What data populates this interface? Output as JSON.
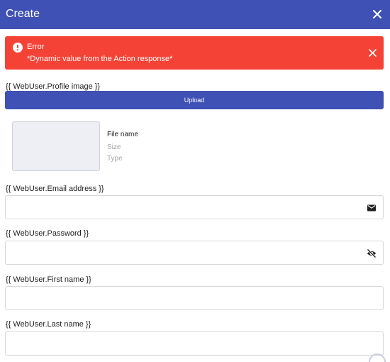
{
  "dialog": {
    "title": "Create",
    "close_icon": "close-icon"
  },
  "alert": {
    "title": "Error",
    "message": "*Dynamic value from the Action response*",
    "icon": "error-icon",
    "background_color": "#f44336"
  },
  "profile_image": {
    "label": "{{ WebUser.Profile image }}",
    "upload_label": "Upload",
    "file_name": "File name",
    "file_size": "Size",
    "file_type": "Type"
  },
  "email": {
    "label": "{{ WebUser.Email address }}",
    "value": "",
    "icon": "mail-icon"
  },
  "password": {
    "label": "{{ WebUser.Password }}",
    "value": "",
    "icon": "visibility-off-icon"
  },
  "first_name": {
    "label": "{{ WebUser.First name }}",
    "value": ""
  },
  "last_name": {
    "label": "{{ WebUser.Last name }}",
    "value": ""
  },
  "colors": {
    "primary": "#3f51b5",
    "error": "#f44336"
  }
}
